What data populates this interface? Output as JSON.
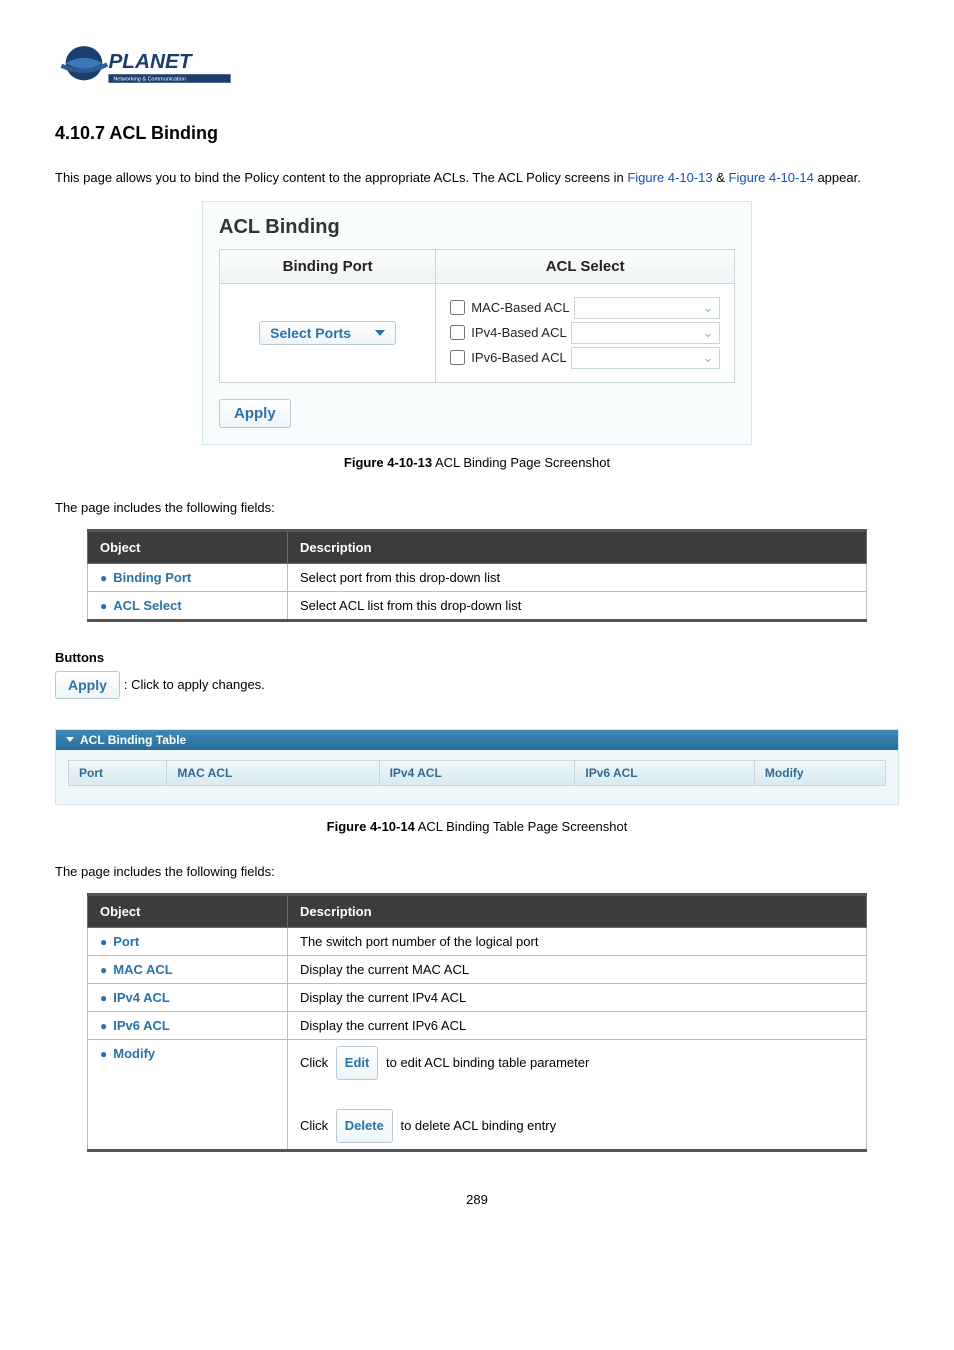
{
  "logo": {
    "brand": "PLANET",
    "tagline": "Networking & Communication"
  },
  "section": {
    "heading": "4.10.7 ACL Binding",
    "intro_pre": "This page allows you to bind the Policy content to the appropriate ACLs. The ACL Policy screens in ",
    "fig_link_1": "Figure 4-10-13",
    "intro_amp": " & ",
    "fig_link_2": "Figure 4-10-14",
    "intro_post": " appear."
  },
  "panel": {
    "title": "ACL Binding",
    "col_binding_port": "Binding Port",
    "col_acl_select": "ACL Select",
    "select_ports_label": "Select Ports",
    "opts": {
      "mac": "MAC-Based ACL",
      "ipv4": "IPv4-Based ACL",
      "ipv6": "IPv6-Based ACL"
    },
    "apply": "Apply"
  },
  "fig13": {
    "bold": "Figure 4-10-13",
    "rest": " ACL Binding Page Screenshot"
  },
  "fields_intro": "The page includes the following fields:",
  "table1": {
    "h_object": "Object",
    "h_desc": "Description",
    "rows": [
      {
        "name": "Binding Port",
        "desc": "Select port from this drop-down list"
      },
      {
        "name": "ACL Select",
        "desc": "Select ACL list from this drop-down list"
      }
    ]
  },
  "buttons": {
    "heading": "Buttons",
    "apply_label": "Apply",
    "apply_desc": ": Click to apply changes."
  },
  "binding_table": {
    "title": "ACL Binding Table",
    "cols": {
      "port": "Port",
      "mac": "MAC ACL",
      "ipv4": "IPv4 ACL",
      "ipv6": "IPv6 ACL",
      "modify": "Modify"
    }
  },
  "fig14": {
    "bold": "Figure 4-10-14",
    "rest": " ACL Binding Table Page Screenshot"
  },
  "table2": {
    "h_object": "Object",
    "h_desc": "Description",
    "rows": [
      {
        "name": "Port",
        "desc": "The switch port number of the logical port"
      },
      {
        "name": "MAC ACL",
        "desc": "Display the current MAC ACL"
      },
      {
        "name": "IPv4 ACL",
        "desc": "Display the current IPv4 ACL"
      },
      {
        "name": "IPv6 ACL",
        "desc": "Display the current IPv6 ACL"
      }
    ],
    "modify_row": {
      "name": "Modify",
      "click": "Click",
      "edit_btn": "Edit",
      "edit_desc": " to edit ACL binding table parameter",
      "delete_btn": "Delete",
      "delete_desc": " to delete ACL binding entry"
    }
  },
  "page_number": "289"
}
